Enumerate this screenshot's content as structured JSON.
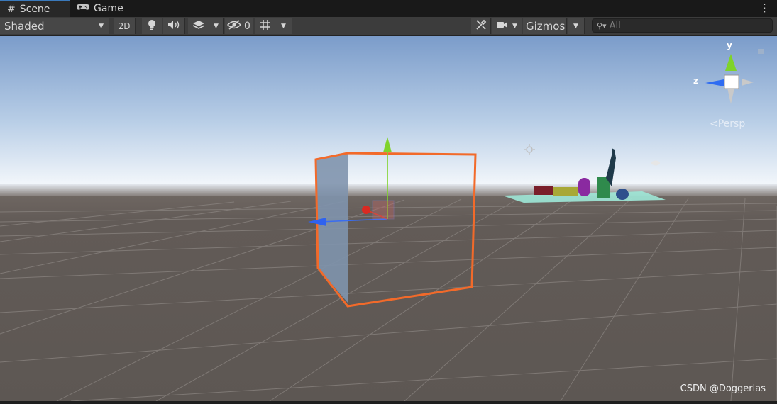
{
  "tabs": [
    {
      "label": "Scene",
      "icon": "hash-icon",
      "active": true
    },
    {
      "label": "Game",
      "icon": "gamepad-icon",
      "active": false
    }
  ],
  "toolbar": {
    "draw_mode": "Shaded",
    "mode_2d": "2D",
    "hidden_count": "0",
    "gizmos_label": "Gizmos",
    "search_placeholder": "All"
  },
  "orientation_gizmo": {
    "y_label": "y",
    "z_label": "z",
    "projection_label": "Persp",
    "colors": {
      "y_axis": "#7fd32a",
      "z_axis": "#2f6cf2",
      "x_axis": "#d93a2a"
    }
  },
  "scene": {
    "selection_outline_color": "#f26a2a",
    "sky_top": "#7e9ecb",
    "horizon": "#f2f6fb",
    "ground": "#5f5955"
  },
  "watermark": "CSDN @Doggerlas"
}
